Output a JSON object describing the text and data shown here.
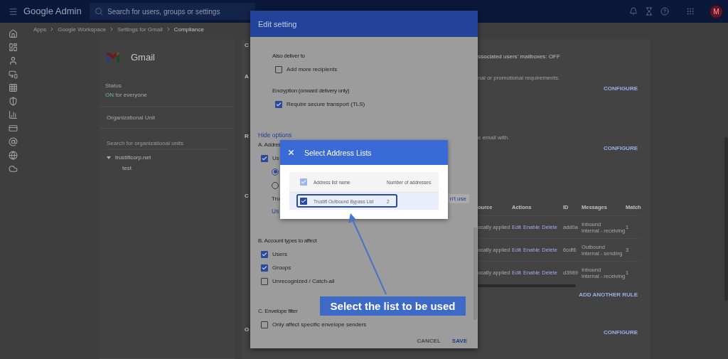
{
  "topbar": {
    "product": "Google Admin",
    "search_placeholder": "Search for users, groups or settings",
    "avatar": "M"
  },
  "breadcrumb": [
    "Apps",
    "Google Workspace",
    "Settings for Gmail",
    "Compliance"
  ],
  "app_card": {
    "name": "Gmail",
    "status_label": "Status",
    "status_value": "ON",
    "status_rest": "for everyone",
    "ou_heading": "Organizational Unit",
    "ou_search_placeholder": "Search for organizational units",
    "tree": [
      {
        "label": "trustificorp.net",
        "expanded": true,
        "children": [
          {
            "label": "test"
          }
        ]
      }
    ]
  },
  "settings_card": {
    "sections": [
      {
        "edge": "C",
        "text": "ssociated users' mailboxes: OFF"
      },
      {
        "edge": "A",
        "hint": "nal or promotional requirements.",
        "action": "CONFIGURE"
      },
      {
        "edge": "R",
        "hint": "e email with.",
        "action": "CONFIGURE"
      },
      {
        "edge": "C",
        "table": {
          "columns": [
            "ource",
            "Actions",
            "ID",
            "Messages",
            "Match"
          ],
          "rows": [
            {
              "source": "ocally applied",
              "actions": [
                "Edit",
                "Enable",
                "Delete"
              ],
              "id": "add0a",
              "messages": [
                "Inbound",
                "internal - receiving"
              ],
              "match": "1"
            },
            {
              "source": "ocally applied",
              "actions": [
                "Edit",
                "Enable",
                "Delete"
              ],
              "id": "6cdf6",
              "messages": [
                "Outbound",
                "internal - sending"
              ],
              "match": "3"
            },
            {
              "source": "ocally applied",
              "actions": [
                "Edit",
                "Enable",
                "Delete"
              ],
              "id": "d3989",
              "messages": [
                "Inbound",
                "internal - receiving"
              ],
              "match": "1"
            }
          ]
        },
        "action": "ADD ANOTHER RULE"
      },
      {
        "edge": "O",
        "action": "CONFIGURE"
      }
    ]
  },
  "edit_dialog": {
    "title": "Edit setting",
    "items": [
      {
        "kind": "group",
        "children": [
          {
            "kind": "heading",
            "text": "Also deliver to"
          },
          {
            "kind": "checkbox",
            "label": "Add more recipients",
            "checked": false
          },
          {
            "kind": "heading",
            "text": "Encryption (onward delivery only)"
          },
          {
            "kind": "checkbox",
            "label": "Require secure transport (TLS)",
            "checked": true
          }
        ]
      },
      {
        "kind": "link",
        "text": "Hide options"
      },
      {
        "kind": "heading",
        "text": "A. Addres"
      },
      {
        "kind": "checkbox",
        "label": "Us",
        "checked": true
      },
      {
        "kind": "radio",
        "selected": true
      },
      {
        "kind": "radio",
        "selected": false
      },
      {
        "kind": "split",
        "text": "Tru",
        "right": "n't use"
      },
      {
        "kind": "sublink",
        "text": "Us"
      },
      {
        "kind": "heading",
        "text": "B. Account types to affect"
      },
      {
        "kind": "checkbox",
        "label": "Users",
        "checked": true
      },
      {
        "kind": "checkbox",
        "label": "Groups",
        "checked": true
      },
      {
        "kind": "checkbox",
        "label": "Unrecognized / Catch-all",
        "checked": false
      },
      {
        "kind": "heading",
        "text": "C. Envelope filter"
      },
      {
        "kind": "checkbox",
        "label": "Only affect specific envelope senders",
        "checked": false
      }
    ],
    "buttons": [
      {
        "label": "CANCEL",
        "primary": false
      },
      {
        "label": "SAVE",
        "primary": true
      }
    ]
  },
  "address_dialog": {
    "title": "Select Address Lists",
    "columns": [
      "Address list name",
      "Number of addresses"
    ],
    "all_checked": true,
    "rows": [
      {
        "name": "Trustifi Outbound Bypass List",
        "count": "2",
        "checked": true,
        "highlighted": true
      }
    ]
  },
  "callout": {
    "text": "Select the list to be used"
  }
}
